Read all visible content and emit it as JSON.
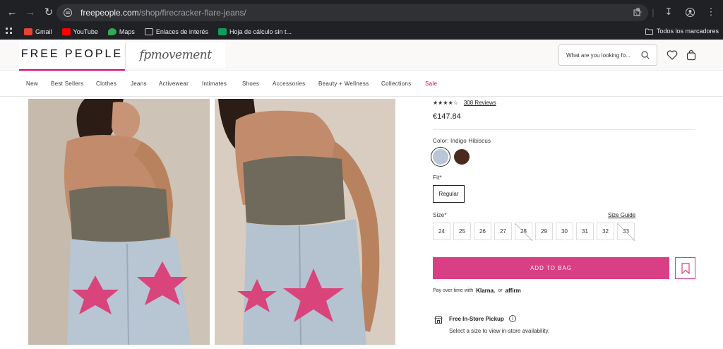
{
  "browser": {
    "url_host": "freepeople.com",
    "url_path": "/shop/firecracker-flare-jeans/",
    "bookmarks": [
      {
        "label": "Gmail",
        "icon": "gmail-icon",
        "color": "#ea4335"
      },
      {
        "label": "YouTube",
        "icon": "youtube-icon",
        "color": "#ff0000"
      },
      {
        "label": "Maps",
        "icon": "maps-icon",
        "color": "#34a853"
      },
      {
        "label": "Enlaces de interés",
        "icon": "folder-icon",
        "color": "#c6c6c6"
      },
      {
        "label": "Hoja de cálculo sin t...",
        "icon": "sheets-icon",
        "color": "#0f9d58"
      }
    ],
    "bookmarks_right": "Todos los marcadores"
  },
  "header": {
    "logo": "FREE PEOPLE",
    "movement_logo": "fpmovement",
    "search_placeholder": "What are you looking fo..."
  },
  "nav": {
    "items": [
      "New",
      "Best Sellers",
      "Clothes",
      "Jeans",
      "Activewear",
      "Intimates",
      "Shoes",
      "Accessories",
      "Beauty + Wellness",
      "Collections",
      "Sale"
    ]
  },
  "product": {
    "rating_stars": "★★★★☆",
    "rating": 4,
    "reviews": "308 Reviews",
    "price": "€147.84",
    "color_label": "Color: Indigo Hibiscus",
    "swatches": [
      {
        "name": "Indigo Hibiscus",
        "color": "#b8c6d8",
        "selected": true
      },
      {
        "name": "Dark",
        "color": "#4a2a20",
        "selected": false
      }
    ],
    "fit_label": "Fit*",
    "fit_value": "Regular",
    "size_label": "Size*",
    "size_guide": "Size Guide",
    "sizes": [
      {
        "label": "24",
        "available": true
      },
      {
        "label": "25",
        "available": true
      },
      {
        "label": "26",
        "available": true
      },
      {
        "label": "27",
        "available": true
      },
      {
        "label": "28",
        "available": false
      },
      {
        "label": "29",
        "available": true
      },
      {
        "label": "30",
        "available": true
      },
      {
        "label": "31",
        "available": true
      },
      {
        "label": "32",
        "available": true
      },
      {
        "label": "33",
        "available": false
      }
    ],
    "add_to_bag": "ADD TO BAG",
    "pay_text": "Pay over time with",
    "klarna": "Klarna.",
    "or": "or",
    "affirm": "affirm",
    "pickup_title": "Free In-Store Pickup",
    "pickup_sub": "Select a size to view in-store availability."
  },
  "colors": {
    "accent": "#d93f84",
    "sale": "#d10052"
  }
}
